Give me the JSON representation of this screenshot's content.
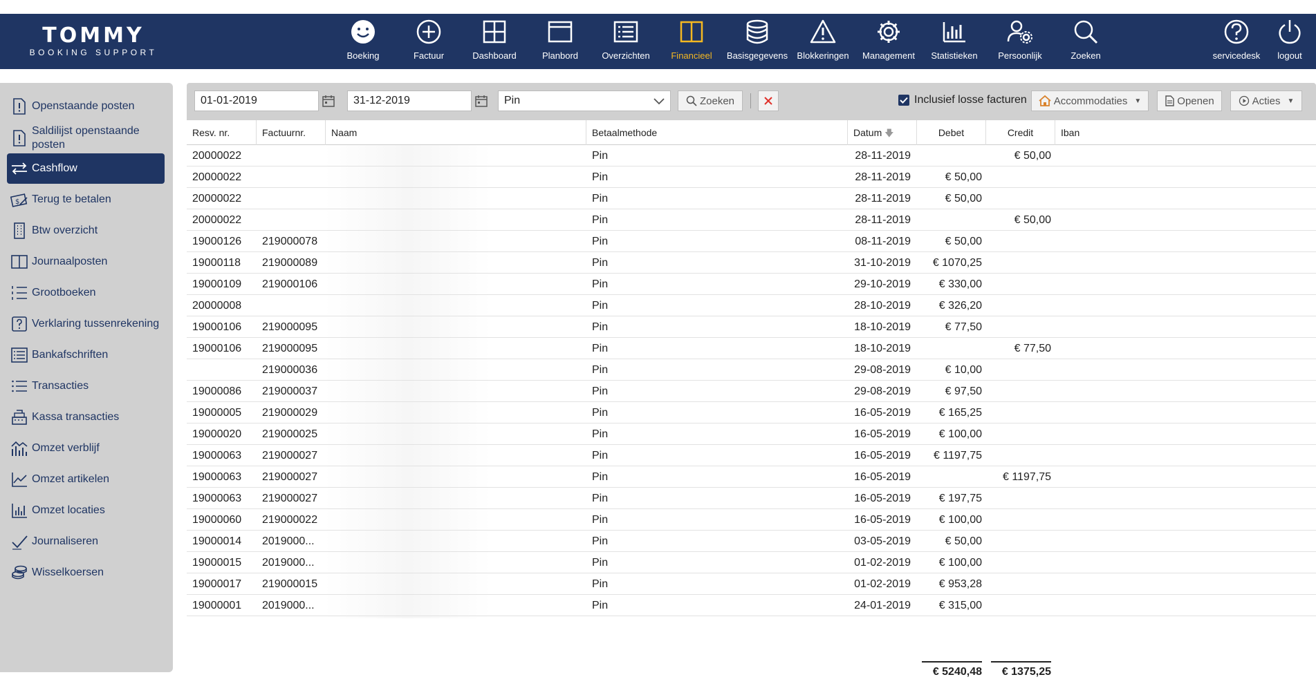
{
  "brand": {
    "name": "TOMMY",
    "subtitle": "BOOKING SUPPORT"
  },
  "nav": {
    "items": [
      {
        "label": "Boeking",
        "icon": "smiley-icon"
      },
      {
        "label": "Factuur",
        "icon": "plus-circle-icon"
      },
      {
        "label": "Dashboard",
        "icon": "grid-icon"
      },
      {
        "label": "Planbord",
        "icon": "window-icon"
      },
      {
        "label": "Overzichten",
        "icon": "list-box-icon"
      },
      {
        "label": "Financieel",
        "icon": "columns-icon",
        "active": true
      },
      {
        "label": "Basisgegevens",
        "icon": "database-icon"
      },
      {
        "label": "Blokkeringen",
        "icon": "warning-icon"
      },
      {
        "label": "Management",
        "icon": "gear-icon"
      },
      {
        "label": "Statistieken",
        "icon": "bar-chart-icon"
      },
      {
        "label": "Persoonlijk",
        "icon": "user-gear-icon"
      },
      {
        "label": "Zoeken",
        "icon": "search-icon"
      }
    ],
    "right": [
      {
        "label": "servicedesk",
        "icon": "help-circle-icon"
      },
      {
        "label": "logout",
        "icon": "power-icon"
      }
    ],
    "active_color": "#f5b821"
  },
  "sidebar": {
    "items": [
      {
        "label": "Openstaande posten",
        "icon": "doc-exclamation-icon"
      },
      {
        "label": "Saldilijst openstaande posten",
        "icon": "doc-exclamation-icon"
      },
      {
        "label": "Cashflow",
        "icon": "transfer-arrows-icon",
        "active": true
      },
      {
        "label": "Terug te betalen",
        "icon": "refund-icon"
      },
      {
        "label": "Btw overzicht",
        "icon": "building-icon"
      },
      {
        "label": "Journaalposten",
        "icon": "columns-icon"
      },
      {
        "label": "Grootboeken",
        "icon": "numbered-list-icon"
      },
      {
        "label": "Verklaring tussenrekening",
        "icon": "question-box-icon"
      },
      {
        "label": "Bankafschriften",
        "icon": "list-box-icon"
      },
      {
        "label": "Transacties",
        "icon": "bullet-list-icon"
      },
      {
        "label": "Kassa transacties",
        "icon": "cash-register-icon"
      },
      {
        "label": "Omzet verblijf",
        "icon": "chart-house-icon"
      },
      {
        "label": "Omzet artikelen",
        "icon": "line-chart-icon"
      },
      {
        "label": "Omzet locaties",
        "icon": "bar-chart-icon"
      },
      {
        "label": "Journaliseren",
        "icon": "check-icon"
      },
      {
        "label": "Wisselkoersen",
        "icon": "coins-icon"
      }
    ]
  },
  "toolbar": {
    "date_from": "01-01-2019",
    "date_to": "31-12-2019",
    "payment_method": "Pin",
    "search_label": "Zoeken",
    "include_loose_label": "Inclusief losse facturen",
    "include_loose_checked": true,
    "accommodations_label": "Accommodaties",
    "open_label": "Openen",
    "actions_label": "Acties"
  },
  "table": {
    "headers": {
      "resv": "Resv. nr.",
      "invoice": "Factuurnr.",
      "name": "Naam",
      "method": "Betaalmethode",
      "date": "Datum",
      "debit": "Debet",
      "credit": "Credit",
      "iban": "Iban"
    },
    "rows": [
      {
        "resv": "20000022",
        "invoice": "",
        "method": "Pin",
        "date": "28-11-2019",
        "debit": "",
        "credit": "€ 50,00"
      },
      {
        "resv": "20000022",
        "invoice": "",
        "method": "Pin",
        "date": "28-11-2019",
        "debit": "€ 50,00",
        "credit": ""
      },
      {
        "resv": "20000022",
        "invoice": "",
        "method": "Pin",
        "date": "28-11-2019",
        "debit": "€ 50,00",
        "credit": ""
      },
      {
        "resv": "20000022",
        "invoice": "",
        "method": "Pin",
        "date": "28-11-2019",
        "debit": "",
        "credit": "€ 50,00"
      },
      {
        "resv": "19000126",
        "invoice": "219000078",
        "method": "Pin",
        "date": "08-11-2019",
        "debit": "€ 50,00",
        "credit": ""
      },
      {
        "resv": "19000118",
        "invoice": "219000089",
        "method": "Pin",
        "date": "31-10-2019",
        "debit": "€ 1070,25",
        "credit": ""
      },
      {
        "resv": "19000109",
        "invoice": "219000106",
        "method": "Pin",
        "date": "29-10-2019",
        "debit": "€ 330,00",
        "credit": ""
      },
      {
        "resv": "20000008",
        "invoice": "",
        "method": "Pin",
        "date": "28-10-2019",
        "debit": "€ 326,20",
        "credit": ""
      },
      {
        "resv": "19000106",
        "invoice": "219000095",
        "method": "Pin",
        "date": "18-10-2019",
        "debit": "€ 77,50",
        "credit": ""
      },
      {
        "resv": "19000106",
        "invoice": "219000095",
        "method": "Pin",
        "date": "18-10-2019",
        "debit": "",
        "credit": "€ 77,50"
      },
      {
        "resv": "",
        "invoice": "219000036",
        "method": "Pin",
        "date": "29-08-2019",
        "debit": "€ 10,00",
        "credit": ""
      },
      {
        "resv": "19000086",
        "invoice": "219000037",
        "method": "Pin",
        "date": "29-08-2019",
        "debit": "€ 97,50",
        "credit": ""
      },
      {
        "resv": "19000005",
        "invoice": "219000029",
        "method": "Pin",
        "date": "16-05-2019",
        "debit": "€ 165,25",
        "credit": ""
      },
      {
        "resv": "19000020",
        "invoice": "219000025",
        "method": "Pin",
        "date": "16-05-2019",
        "debit": "€ 100,00",
        "credit": ""
      },
      {
        "resv": "19000063",
        "invoice": "219000027",
        "method": "Pin",
        "date": "16-05-2019",
        "debit": "€ 1197,75",
        "credit": ""
      },
      {
        "resv": "19000063",
        "invoice": "219000027",
        "method": "Pin",
        "date": "16-05-2019",
        "debit": "",
        "credit": "€ 1197,75"
      },
      {
        "resv": "19000063",
        "invoice": "219000027",
        "method": "Pin",
        "date": "16-05-2019",
        "debit": "€ 197,75",
        "credit": ""
      },
      {
        "resv": "19000060",
        "invoice": "219000022",
        "method": "Pin",
        "date": "16-05-2019",
        "debit": "€ 100,00",
        "credit": ""
      },
      {
        "resv": "19000014",
        "invoice": "2019000...",
        "method": "Pin",
        "date": "03-05-2019",
        "debit": "€ 50,00",
        "credit": ""
      },
      {
        "resv": "19000015",
        "invoice": "2019000...",
        "method": "Pin",
        "date": "01-02-2019",
        "debit": "€ 100,00",
        "credit": ""
      },
      {
        "resv": "19000017",
        "invoice": "219000015",
        "method": "Pin",
        "date": "01-02-2019",
        "debit": "€ 953,28",
        "credit": ""
      },
      {
        "resv": "19000001",
        "invoice": "2019000...",
        "method": "Pin",
        "date": "24-01-2019",
        "debit": "€ 315,00",
        "credit": ""
      }
    ],
    "totals": {
      "debit": "€ 5240,48",
      "credit": "€ 1375,25"
    }
  }
}
